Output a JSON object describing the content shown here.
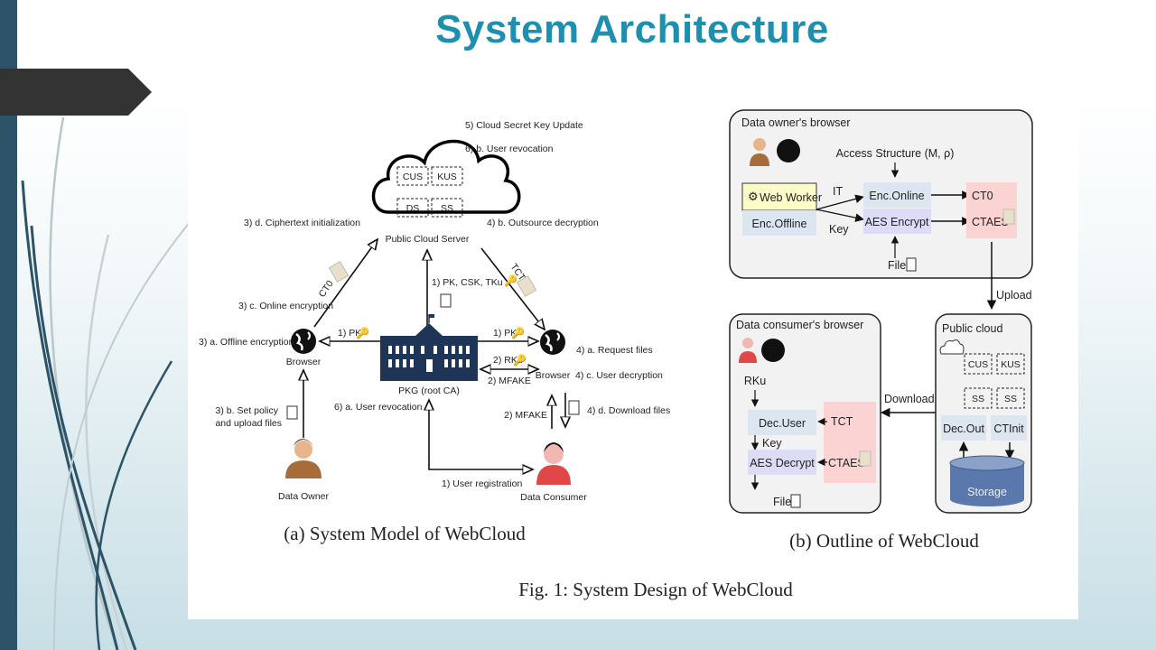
{
  "slide": {
    "title": "System Architecture",
    "colors": {
      "title": "#1e8fae",
      "sidebar": "#2d5369",
      "banner": "#333333",
      "accent_red": "#fbd3d3",
      "accent_blue": "#dce6f0",
      "accent_purple": "#dcdcf6",
      "accent_yellow": "#fcfcc8",
      "pkg": "#1f3557",
      "storage": "#5a78ab"
    }
  },
  "figure": {
    "caption": "Fig. 1: System Design of WebCloud",
    "panel_a": {
      "caption": "(a) System Model of WebCloud",
      "cloud": {
        "label": "Public Cloud Server",
        "modules": [
          "CUS",
          "KUS",
          "DS",
          "SS"
        ]
      },
      "pkg_label": "PKG (root CA)",
      "owner_browser_label": "Browser",
      "consumer_browser_label": "Browser",
      "data_owner_label": "Data Owner",
      "data_consumer_label": "Data Consumer",
      "steps": {
        "s5": "5) Cloud Secret Key Update",
        "s6b": "6) b. User revocation",
        "s3d": "3) d. Ciphertext initialization",
        "s4b": "4) b. Outsource decryption",
        "s1_cloud": "1) PK, CSK, TKu",
        "s3c": "3) c. Online encryption",
        "ct0": "CT0",
        "tct": "TCT",
        "s3a": "3) a. Offline encryption",
        "s1_pk_left": "1) PK",
        "s1_pk_right": "1) PK",
        "s2_rku": "2) RKu",
        "s2_mfake": "2) MFAKE",
        "s2_mfake_v": "2) MFAKE",
        "s4a": "4) a. Request files",
        "s4c": "4) c. User decryption",
        "s4d": "4) d. Download files",
        "s3b_1": "3) b. Set policy",
        "s3b_2": "and upload files",
        "s6a": "6) a. User revocation",
        "s1_reg": "1) User registration"
      }
    },
    "panel_b": {
      "caption": "(b) Outline of WebCloud",
      "owner_box": {
        "title": "Data owner's browser",
        "access_structure": "Access Structure (M, ρ)",
        "web_worker": "Web Worker",
        "enc_offline": "Enc.Offline",
        "it": "IT",
        "key": "Key",
        "enc_online": "Enc.Online",
        "aes_encrypt": "AES Encrypt",
        "ct0": "CT0",
        "ctaes": "CTAES",
        "file": "File"
      },
      "upload": "Upload",
      "download": "Download",
      "consumer_box": {
        "title": "Data consumer's browser",
        "rku": "RKu",
        "dec_user": "Dec.User",
        "key": "Key",
        "aes_decrypt": "AES Decrypt",
        "tct": "TCT",
        "ctaes": "CTAES",
        "file": "File"
      },
      "cloud_box": {
        "title": "Public cloud",
        "modules": [
          "CUS",
          "KUS",
          "SS",
          "SS"
        ],
        "dec_out": "Dec.Out",
        "ctinit": "CTInit",
        "storage": "Storage"
      }
    }
  }
}
